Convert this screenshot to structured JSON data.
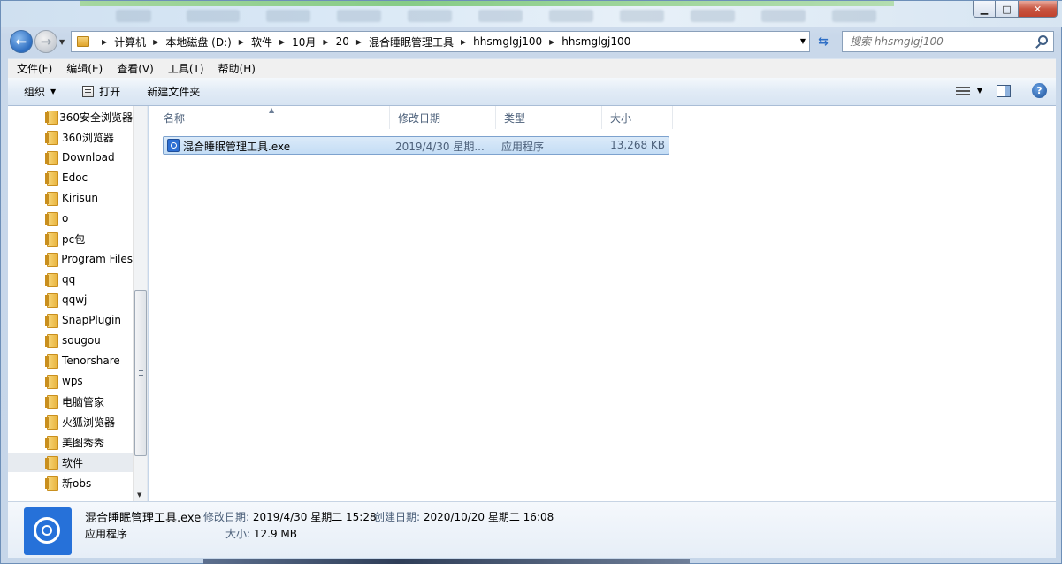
{
  "window": {
    "caption": {
      "minimize": "▁",
      "maximize": "□",
      "close": "✕"
    }
  },
  "nav": {
    "back_icon": "arrow-left-icon",
    "forward_icon": "arrow-right-icon",
    "breadcrumb": [
      "计算机",
      "本地磁盘 (D:)",
      "软件",
      "10月",
      "20",
      "混合睡眠管理工具",
      "hhsmglgj100",
      "hhsmglgj100"
    ],
    "search_placeholder": "搜索 hhsmglgj100"
  },
  "menubar": [
    "文件(F)",
    "编辑(E)",
    "查看(V)",
    "工具(T)",
    "帮助(H)"
  ],
  "commandbar": {
    "organize": "组织",
    "open": "打开",
    "new_folder": "新建文件夹"
  },
  "tree": {
    "items": [
      "360安全浏览器",
      "360浏览器",
      "Download",
      "Edoc",
      "Kirisun",
      "o",
      "pc包",
      "Program Files",
      "qq",
      "qqwj",
      "SnapPlugin",
      "sougou",
      "Tenorshare",
      "wps",
      "电脑管家",
      "火狐浏览器",
      "美图秀秀",
      "软件",
      "新obs"
    ],
    "selected": "软件"
  },
  "columns": [
    "名称",
    "修改日期",
    "类型",
    "大小"
  ],
  "files": [
    {
      "name": "混合睡眠管理工具.exe",
      "modified": "2019/4/30 星期...",
      "type": "应用程序",
      "size": "13,268 KB"
    }
  ],
  "details": {
    "filename": "混合睡眠管理工具.exe",
    "modified_label": "修改日期:",
    "modified_value": "2019/4/30 星期二 15:28",
    "created_label": "创建日期:",
    "created_value": "2020/10/20 星期二 16:08",
    "type": "应用程序",
    "size_label": "大小:",
    "size_value": "12.9 MB"
  },
  "colors": {
    "accent": "#2d6fd3",
    "selection": "#c4ddf5"
  }
}
